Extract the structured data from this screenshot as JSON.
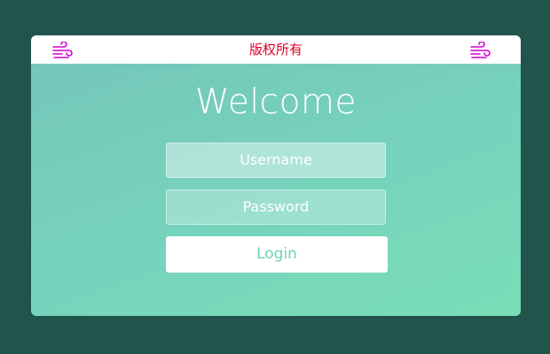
{
  "header": {
    "copyright": "版权所有",
    "left_icon": "wind-icon",
    "right_icon": "wind-icon"
  },
  "login_form": {
    "title": "Welcome",
    "username_placeholder": "Username",
    "password_placeholder": "Password",
    "login_label": "Login"
  },
  "colors": {
    "page_background": "#21544a",
    "card_gradient_start": "#74c5b9",
    "card_gradient_end": "#79deb8",
    "icon_color": "#d400d4",
    "copyright_color": "#e0002a",
    "login_text_color": "#6fd3b3"
  }
}
